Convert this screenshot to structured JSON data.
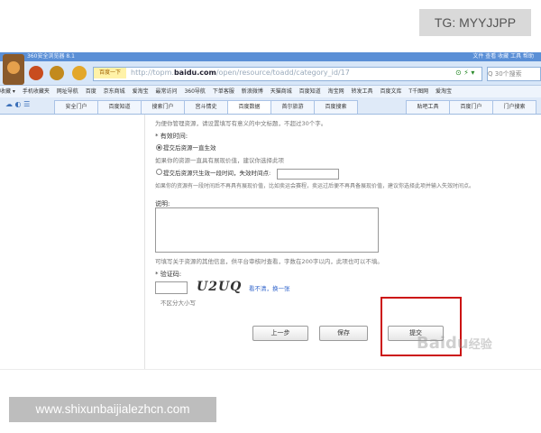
{
  "watermark": {
    "tg": "TG: MYYJJPP",
    "site": "www.shixunbaijialezhcn.com"
  },
  "browser": {
    "title": "360安全浏览器 8.1",
    "title_right": "文件  查看  收藏  工具  帮助",
    "engine": "百度一下",
    "url_prefix": "http://topm.",
    "url_domain": "baidu.com",
    "url_path": "/open/resource/toadd/category_id/17",
    "nav_icons": "⊙ ⚡ ▾",
    "search_placeholder": "Q 30个搜索",
    "favorites": [
      "收藏 ▾",
      "手机收藏夹",
      "网址导航",
      "百度",
      "京东商城",
      "爱淘宝",
      "最常访问",
      "360导航",
      "下单客服",
      "新浪微博",
      "天猫商城",
      "百度知道",
      "淘宝网",
      "转发工具",
      "百度文库",
      "T千图网",
      "爱淘宝"
    ],
    "tabs": [
      "安全门户",
      "百度知道",
      "搜索门户",
      "宫斗情史",
      "百度数据",
      "首尔旅游",
      "百度搜索",
      "贴吧工具",
      "百度门户",
      "门户搜索"
    ],
    "active_tab": 4
  },
  "form": {
    "top_hint": "为便你管理资源，请设置填写有意义的中文标题，不超过30个字。",
    "validity_label": "* 有效时间:",
    "option1": "提交后资源一直生效",
    "option1_hint": "如果你的资源一直具有展现价值，建议你选择此项",
    "option2": "提交后资源只生效一段时间，失效时间点:",
    "option2_hint": "如果你的资源有一段时间后不再具有展现价值，比如卖运会赛程，卖运过后便不再具备展现价值，建议你选择此项并输入失效时间点。",
    "reason_label": "说明:",
    "reason_hint": "可填写关于资源的其他信息，供平台审核时查看，字数在200字以内，此项也可以不填。",
    "captcha_label": "* 验证码:",
    "captcha_text": "U2UQ",
    "captcha_refresh": "看不清，换一张",
    "captcha_case": "不区分大小写",
    "btn_prev": "上一步",
    "btn_save": "保存",
    "btn_submit": "提交"
  },
  "baidu_watermark": {
    "main": "Bai",
    "paw": "du",
    "suffix": "经验"
  },
  "colors": {
    "highlight": "#cc1212",
    "titlebar": "#5a8fd6"
  }
}
